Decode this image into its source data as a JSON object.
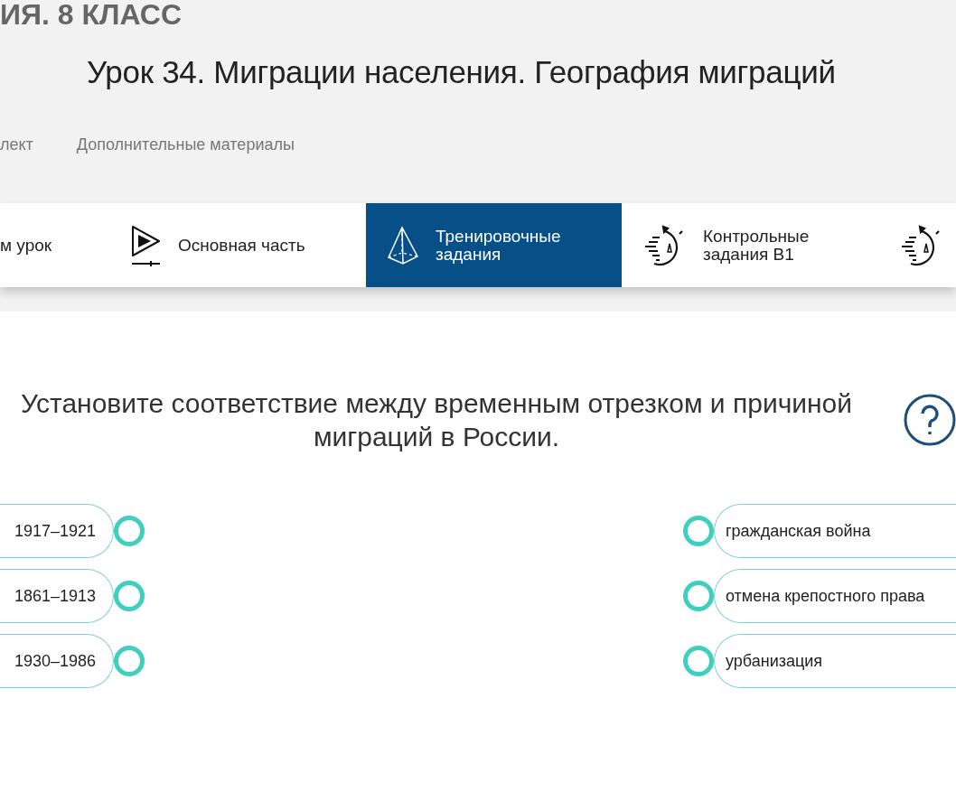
{
  "course_title": "ИЯ. 8 КЛАСС",
  "lesson_title": "Урок 34. Миграции населения. География миграций",
  "nav_links": [
    "лект",
    "Дополнительные материалы"
  ],
  "tabs": [
    {
      "kind": "text",
      "label": "м урок",
      "selected": false
    },
    {
      "kind": "play",
      "label": "Основная часть",
      "selected": false
    },
    {
      "kind": "pyramid",
      "label": "Тренировочные задания",
      "selected": true
    },
    {
      "kind": "timer",
      "label": "Контрольные задания В1",
      "selected": false
    },
    {
      "kind": "timer",
      "selected": false
    }
  ],
  "question": "Установите соответствие между временным отрезком и причиной миграций в России.",
  "left_items": [
    "1917–1921",
    "1861–1913",
    "1930–1986"
  ],
  "right_items": [
    "гражданская война",
    "отмена крепостного права",
    "урбанизация"
  ]
}
